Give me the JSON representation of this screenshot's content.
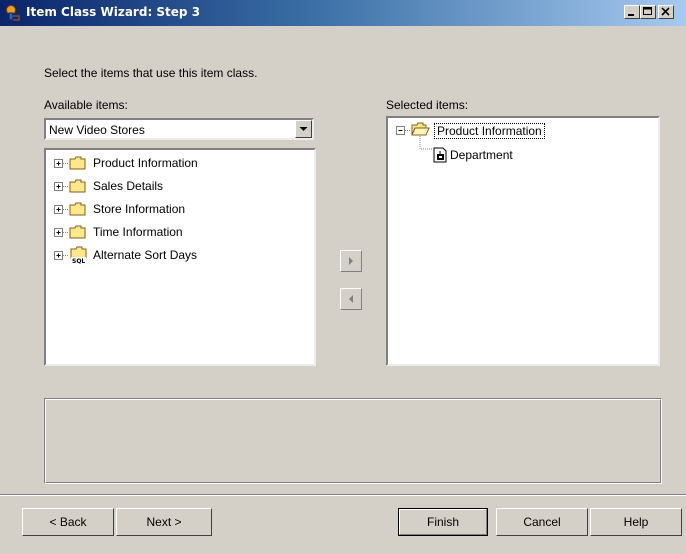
{
  "window": {
    "title": "Item Class Wizard: Step 3",
    "minimize_label": "_",
    "maximize_label": "□",
    "close_label": "X"
  },
  "instructions": "Select the items that use this item class.",
  "available": {
    "label": "Available items:",
    "combo_value": "New Video Stores",
    "tree": [
      {
        "label": "Product Information",
        "icon": "folder-icon"
      },
      {
        "label": "Sales Details",
        "icon": "folder-icon"
      },
      {
        "label": "Store Information",
        "icon": "folder-icon"
      },
      {
        "label": "Time Information",
        "icon": "folder-icon"
      },
      {
        "label": "Alternate Sort Days",
        "icon": "sql-folder-icon"
      }
    ]
  },
  "selected": {
    "label": "Selected items:",
    "tree": [
      {
        "label": "Product Information",
        "icon": "folder-open-icon",
        "expanded": true
      },
      {
        "label": "Department",
        "icon": "item-icon"
      }
    ]
  },
  "buttons": {
    "back": "< Back",
    "next": "Next >",
    "finish": "Finish",
    "cancel": "Cancel",
    "help": "Help"
  },
  "colors": {
    "title_start": "#0a246a",
    "title_end": "#a6caf0",
    "face": "#d4d0c8",
    "folder": "#ffe88a"
  }
}
